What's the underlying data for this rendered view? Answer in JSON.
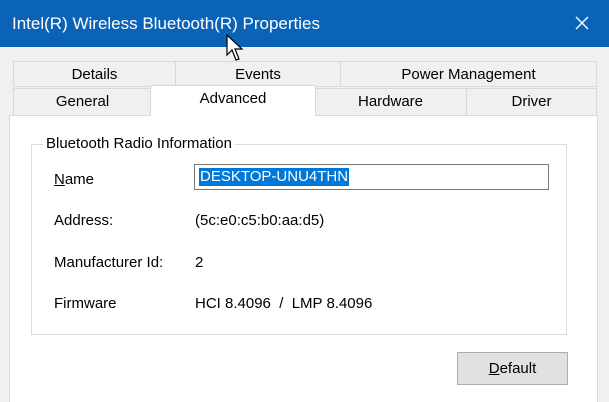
{
  "window": {
    "title": "Intel(R) Wireless Bluetooth(R) Properties",
    "close_icon": "close-icon",
    "titlebar_color": "#0a63b6"
  },
  "tabs": {
    "row_back": [
      {
        "label": "Details"
      },
      {
        "label": "Events"
      },
      {
        "label": "Power Management"
      }
    ],
    "row_front": [
      {
        "label": "General"
      },
      {
        "label": "Advanced",
        "active": true
      },
      {
        "label": "Hardware"
      },
      {
        "label": "Driver"
      }
    ]
  },
  "group": {
    "legend": "Bluetooth Radio Information",
    "name": {
      "label_first": "N",
      "label_rest": "ame",
      "value": "DESKTOP-UNU4THN"
    },
    "address": {
      "label": "Address:",
      "value": "(5c:e0:c5:b0:aa:d5)"
    },
    "manufacturer": {
      "label": "Manufacturer Id:",
      "value": "2"
    },
    "firmware": {
      "label": "Firmware",
      "value": "HCI 8.4096  /  LMP 8.4096"
    }
  },
  "buttons": {
    "default_first": "D",
    "default_rest": "efault"
  },
  "colors": {
    "selection": "#0078d7"
  }
}
